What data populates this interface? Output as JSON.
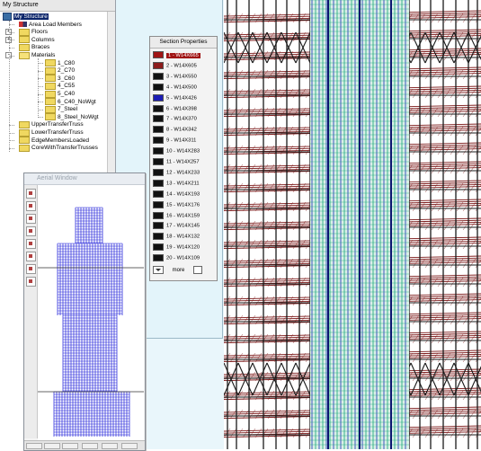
{
  "tree": {
    "title": "My Structure",
    "root_label": "My Structure",
    "items": [
      {
        "label": "Area Load Members",
        "level": 2,
        "icon": "area-load-icon",
        "expander": ""
      },
      {
        "label": "Floors",
        "level": 2,
        "icon": "folder-icon",
        "expander": "+"
      },
      {
        "label": "Columns",
        "level": 2,
        "icon": "folder-icon",
        "expander": "+"
      },
      {
        "label": "Braces",
        "level": 2,
        "icon": "folder-icon",
        "expander": ""
      },
      {
        "label": "Materials",
        "level": 2,
        "icon": "folder-open-icon",
        "expander": "-"
      },
      {
        "label": "1_C80",
        "level": 3,
        "icon": "folder-icon",
        "expander": ""
      },
      {
        "label": "2_C70",
        "level": 3,
        "icon": "folder-icon",
        "expander": ""
      },
      {
        "label": "3_C60",
        "level": 3,
        "icon": "folder-icon",
        "expander": ""
      },
      {
        "label": "4_C55",
        "level": 3,
        "icon": "folder-icon",
        "expander": ""
      },
      {
        "label": "5_C40",
        "level": 3,
        "icon": "folder-icon",
        "expander": ""
      },
      {
        "label": "6_C40_NoWgt",
        "level": 3,
        "icon": "folder-icon",
        "expander": ""
      },
      {
        "label": "7_Steel",
        "level": 3,
        "icon": "folder-icon",
        "expander": ""
      },
      {
        "label": "8_Steel_NoWgt",
        "level": 3,
        "icon": "folder-icon",
        "expander": ""
      },
      {
        "label": "UpperTransferTruss",
        "level": 2,
        "icon": "folder-icon",
        "expander": ""
      },
      {
        "label": "LowerTransferTruss",
        "level": 2,
        "icon": "folder-icon",
        "expander": ""
      },
      {
        "label": "EdgeMembersLoaded",
        "level": 2,
        "icon": "folder-icon",
        "expander": ""
      },
      {
        "label": "CoreWithTransferTrusses",
        "level": 2,
        "icon": "folder-icon",
        "expander": ""
      }
    ]
  },
  "aerial": {
    "title": "Aerial Window"
  },
  "legend": {
    "title": "Section Properties",
    "more_label": "more",
    "entries": [
      {
        "label": "1 - W14X665",
        "color": "#a01414"
      },
      {
        "label": "2 - W14X605",
        "color": "#8c1b1b"
      },
      {
        "label": "3 - W14X550",
        "color": "#111111"
      },
      {
        "label": "4 - W14X500",
        "color": "#111111"
      },
      {
        "label": "5 - W14X426",
        "color": "#1c1cb4"
      },
      {
        "label": "6 - W14X398",
        "color": "#111111"
      },
      {
        "label": "7 - W14X370",
        "color": "#111111"
      },
      {
        "label": "8 - W14X342",
        "color": "#111111"
      },
      {
        "label": "9 - W14X311",
        "color": "#111111"
      },
      {
        "label": "10 - W14X283",
        "color": "#111111"
      },
      {
        "label": "11 - W14X257",
        "color": "#111111"
      },
      {
        "label": "12 - W14X233",
        "color": "#111111"
      },
      {
        "label": "13 - W14X211",
        "color": "#111111"
      },
      {
        "label": "14 - W14X193",
        "color": "#111111"
      },
      {
        "label": "15 - W14X176",
        "color": "#111111"
      },
      {
        "label": "16 - W14X159",
        "color": "#111111"
      },
      {
        "label": "17 - W14X145",
        "color": "#111111"
      },
      {
        "label": "18 - W14X132",
        "color": "#111111"
      },
      {
        "label": "19 - W14X120",
        "color": "#111111"
      },
      {
        "label": "20 - W14X109",
        "color": "#111111"
      }
    ]
  },
  "colors": {
    "beam_red": "#7a1616",
    "column_black": "#1a1a1a",
    "core_blue": "#1c2cb8",
    "core_green": "#17a878",
    "aerial_blue": "#1b1bd8",
    "selection": "#0a246a"
  }
}
